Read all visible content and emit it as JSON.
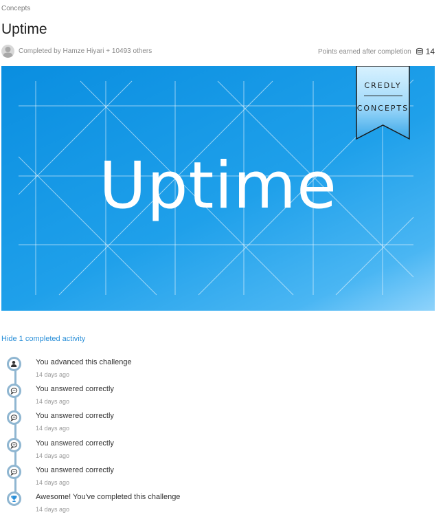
{
  "breadcrumb": "Concepts",
  "title": "Uptime",
  "completed_by": "Completed by Hamze Hiyari + 10493 others",
  "points": {
    "label": "Points earned after completion",
    "value": "14"
  },
  "banner": {
    "title": "Uptime",
    "ribbon_top": "CREDLY",
    "ribbon_bottom": "CONCEPTS",
    "color": "#1a9be6"
  },
  "activity_toggle": "Hide 1 completed activity",
  "activities": [
    {
      "icon": "user-advance-icon",
      "text": "You advanced this challenge",
      "time": "14 days ago"
    },
    {
      "icon": "chat-bubble-icon",
      "text": "You answered correctly",
      "time": "14 days ago"
    },
    {
      "icon": "chat-bubble-icon",
      "text": "You answered correctly",
      "time": "14 days ago"
    },
    {
      "icon": "chat-bubble-icon",
      "text": "You answered correctly",
      "time": "14 days ago"
    },
    {
      "icon": "chat-bubble-icon",
      "text": "You answered correctly",
      "time": "14 days ago"
    },
    {
      "icon": "trophy-icon",
      "text": "Awesome! You've completed this challenge",
      "time": "14 days ago"
    }
  ]
}
